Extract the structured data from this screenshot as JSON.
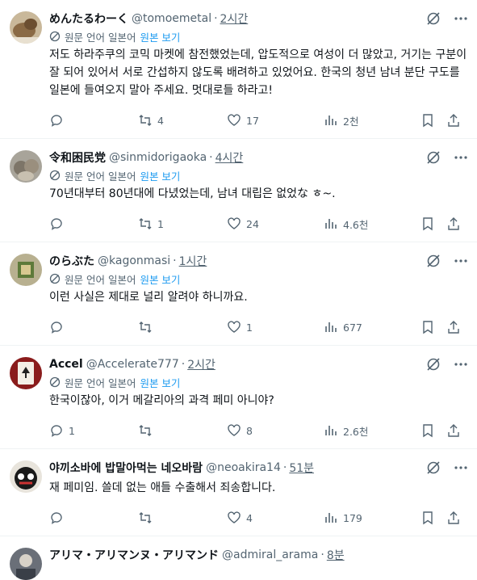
{
  "colors": {
    "link": "#1d9bf0",
    "muted": "#536471",
    "text": "#0f1419",
    "divider": "#eff3f4"
  },
  "translate": {
    "source": "원문 언어 일본어",
    "action": "원본 보기"
  },
  "posts": [
    {
      "name": "めんたるわーく",
      "handle": "@tomoemetal",
      "time": "2시간",
      "text": "저도 하라주쿠의 코믹 마켓에 참전했었는데, 압도적으로 여성이 더 많았고, 거기는 구분이 잘 되어 있어서 서로 간섭하지 않도록 배려하고 있었어요. 한국의 청년 남녀 분단 구도를 일본에 들여오지 말아 주세요. 멋대로들 하라고!",
      "replies": "",
      "reposts": "4",
      "likes": "17",
      "views": "2천"
    },
    {
      "name": "令和困民党",
      "handle": "@sinmidorigaoka",
      "time": "4시간",
      "text": "70년대부터 80년대에 다녔었는데, 남녀 대립은 없었な ㅎ~.",
      "replies": "",
      "reposts": "1",
      "likes": "24",
      "views": "4.6천"
    },
    {
      "name": "のらぶた",
      "handle": "@kagonmasi",
      "time": "1시간",
      "text": "이런 사실은 제대로 널리 알려야 하니까요.",
      "replies": "",
      "reposts": "",
      "likes": "1",
      "views": "677"
    },
    {
      "name": "Accel",
      "handle": "@Accelerate777",
      "time": "2시간",
      "text": "한국이잖아, 이거 메갈리아의 과격 페미 아니야?",
      "replies": "1",
      "reposts": "",
      "likes": "8",
      "views": "2.6천"
    },
    {
      "name": "야끼소바에 밥말아먹는 네오바람",
      "handle": "@neoakira14",
      "time": "51분",
      "text": "재 페미임. 쓸데 없는 애들 수출해서 죄송합니다.",
      "replies": "",
      "reposts": "",
      "likes": "4",
      "views": "179"
    },
    {
      "name": "アリマ・アリマンヌ・アリマンド",
      "handle": "@admiral_arama",
      "time": "8분"
    }
  ]
}
